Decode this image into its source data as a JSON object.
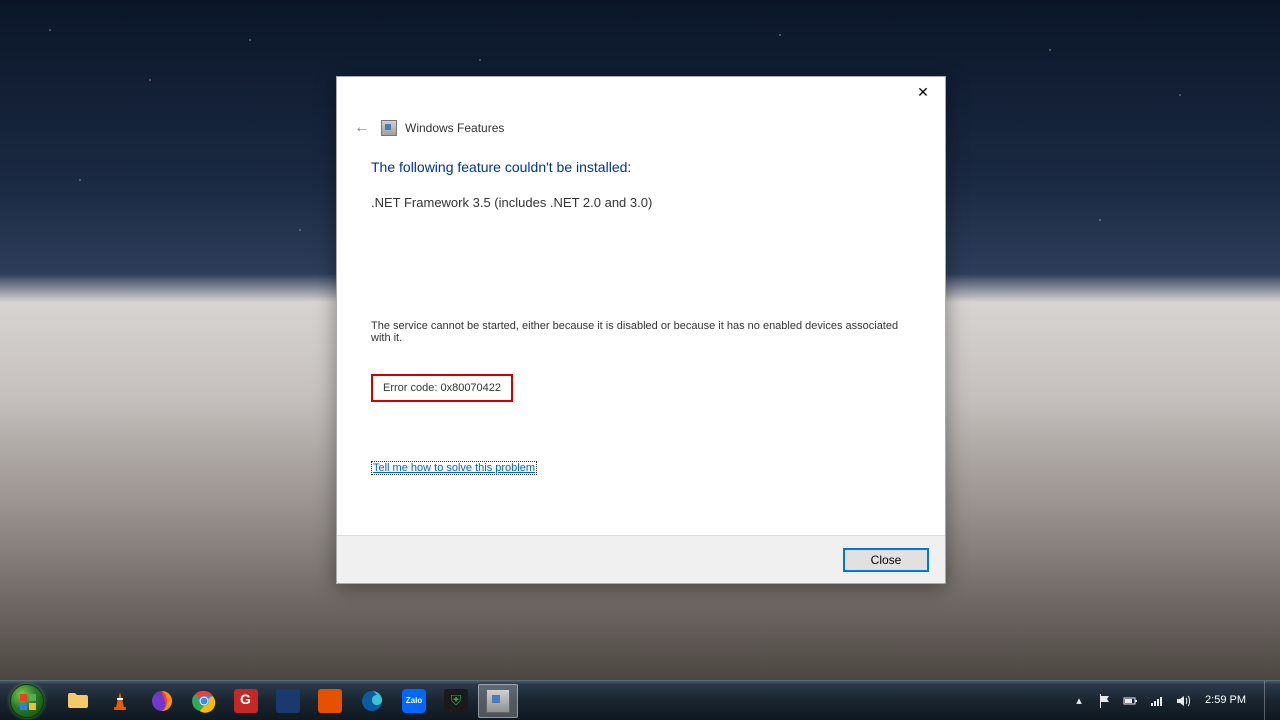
{
  "dialog": {
    "title": "Windows Features",
    "heading": "The following feature couldn't be installed:",
    "feature": ".NET Framework 3.5 (includes .NET 2.0 and 3.0)",
    "service_message": "The service cannot be started, either because it is disabled or because it has no enabled devices associated with it.",
    "error_code": "Error code: 0x80070422",
    "help_link": "Tell me how to solve this problem",
    "close_button": "Close"
  },
  "taskbar": {
    "clock": "2:59 PM"
  }
}
